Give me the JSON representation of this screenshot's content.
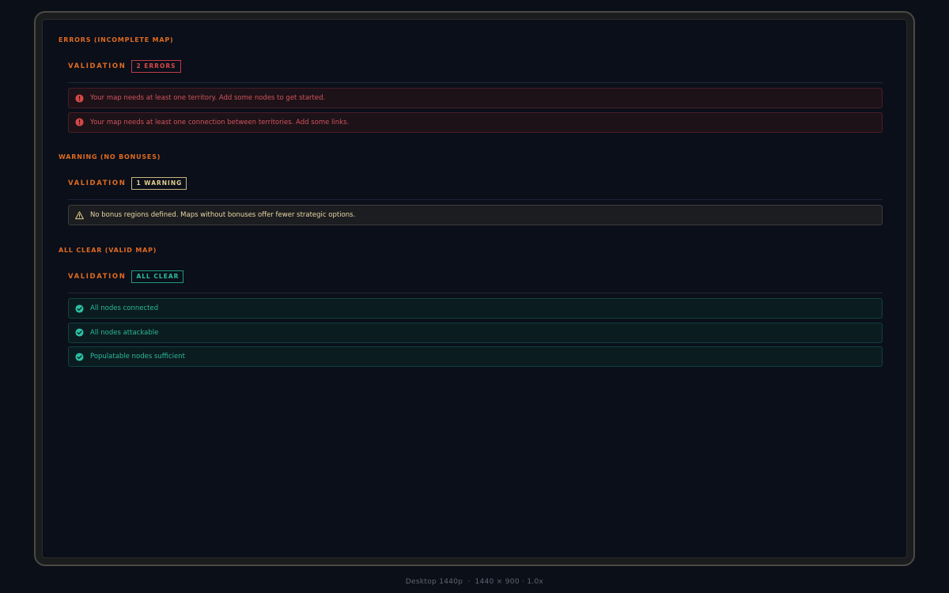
{
  "sections": {
    "errors": {
      "title": "ERRORS (INCOMPLETE MAP)",
      "validation_label": "VALIDATION",
      "badge": "2 ERRORS",
      "items": [
        "Your map needs at least one territory. Add some nodes to get started.",
        "Your map needs at least one connection between territories. Add some links."
      ]
    },
    "warning": {
      "title": "WARNING (NO BONUSES)",
      "validation_label": "VALIDATION",
      "badge": "1 WARNING",
      "items": [
        "No bonus regions defined. Maps without bonuses offer fewer strategic options."
      ]
    },
    "clear": {
      "title": "ALL CLEAR (VALID MAP)",
      "validation_label": "VALIDATION",
      "badge": "ALL CLEAR",
      "items": [
        "All nodes connected",
        "All nodes attackable",
        "Populatable nodes sufficient"
      ]
    }
  },
  "footer": {
    "device": "Desktop 1440p",
    "resolution": "1440 × 900 · 1.0x"
  },
  "colors": {
    "accent": "#e06a20",
    "error": "#d84848",
    "warning": "#e4d090",
    "success": "#2bbfa0"
  },
  "icons": {
    "error": "error-circle-icon",
    "warning": "warning-triangle-icon",
    "success": "check-circle-icon"
  }
}
